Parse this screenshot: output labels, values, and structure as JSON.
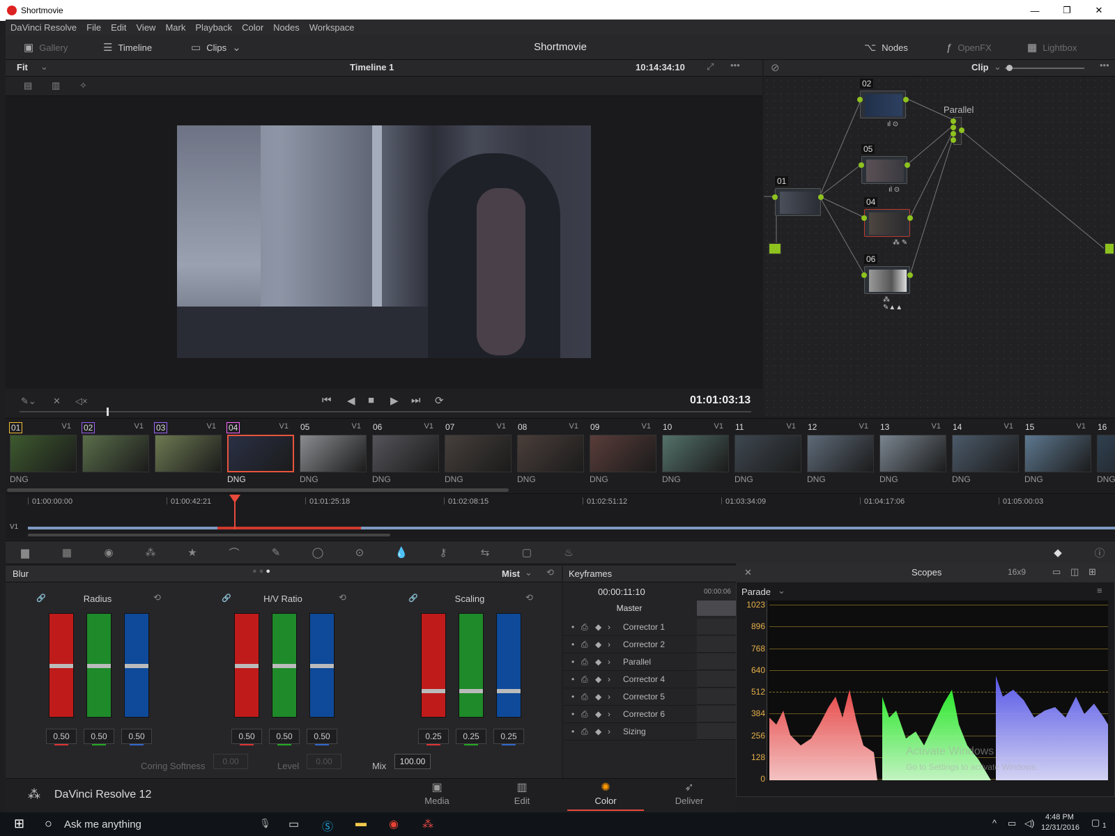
{
  "window": {
    "title": "Shortmovie",
    "controls": [
      "—",
      "❐",
      "✕"
    ]
  },
  "menu": [
    "DaVinci Resolve",
    "File",
    "Edit",
    "View",
    "Mark",
    "Playback",
    "Color",
    "Nodes",
    "Workspace"
  ],
  "toolbar": {
    "gallery": "Gallery",
    "timeline": "Timeline",
    "clips": "Clips",
    "project": "Shortmovie",
    "nodes": "Nodes",
    "openfx": "OpenFX",
    "lightbox": "Lightbox"
  },
  "viewer": {
    "fit": "Fit",
    "timeline_name": "Timeline 1",
    "source_tc": "10:14:34:10",
    "timecode": "01:01:03:13"
  },
  "node_header": {
    "mode": "Clip"
  },
  "nodes": {
    "n01": "01",
    "n02": "02",
    "n05": "05",
    "n04": "04",
    "n06": "06",
    "parallel": "Parallel"
  },
  "clips": [
    {
      "num": "01",
      "track": "V1",
      "fmt": "DNG"
    },
    {
      "num": "02",
      "track": "V1",
      "fmt": ""
    },
    {
      "num": "03",
      "track": "V1",
      "fmt": ""
    },
    {
      "num": "04",
      "track": "V1",
      "fmt": "DNG"
    },
    {
      "num": "05",
      "track": "V1",
      "fmt": "DNG"
    },
    {
      "num": "06",
      "track": "V1",
      "fmt": "DNG"
    },
    {
      "num": "07",
      "track": "V1",
      "fmt": "DNG"
    },
    {
      "num": "08",
      "track": "V1",
      "fmt": "DNG"
    },
    {
      "num": "09",
      "track": "V1",
      "fmt": "DNG"
    },
    {
      "num": "10",
      "track": "V1",
      "fmt": "DNG"
    },
    {
      "num": "11",
      "track": "V1",
      "fmt": "DNG"
    },
    {
      "num": "12",
      "track": "V1",
      "fmt": "DNG"
    },
    {
      "num": "13",
      "track": "V1",
      "fmt": "DNG"
    },
    {
      "num": "14",
      "track": "V1",
      "fmt": "DNG"
    },
    {
      "num": "15",
      "track": "V1",
      "fmt": "DNG"
    },
    {
      "num": "16",
      "track": "",
      "fmt": "DNG"
    }
  ],
  "timeline": {
    "track": "V1",
    "ticks": [
      "01:00:00:00",
      "01:00:42:21",
      "01:01:25:18",
      "01:02:08:15",
      "01:02:51:12",
      "01:03:34:09",
      "01:04:17:06",
      "01:05:00:03"
    ]
  },
  "blur": {
    "title": "Blur",
    "mode": "Mist",
    "groups": [
      {
        "label": "Radius",
        "values": [
          "0.50",
          "0.50",
          "0.50"
        ],
        "level": 0.5
      },
      {
        "label": "H/V Ratio",
        "values": [
          "0.50",
          "0.50",
          "0.50"
        ],
        "level": 0.5
      },
      {
        "label": "Scaling",
        "values": [
          "0.25",
          "0.25",
          "0.25"
        ],
        "level": 0.25
      }
    ],
    "coring_label": "Coring Softness",
    "coring_value": "0.00",
    "level_label": "Level",
    "level_value": "0.00",
    "mix_label": "Mix",
    "mix_value": "100.00"
  },
  "keyframes": {
    "title": "Keyframes",
    "timecode": "00:00:11:10",
    "ruler": "00:00:06",
    "master": "Master",
    "rows": [
      "Corrector 1",
      "Corrector 2",
      "Parallel",
      "Corrector 4",
      "Corrector 5",
      "Corrector 6",
      "Sizing"
    ]
  },
  "scopes": {
    "title": "Scopes",
    "aspect": "16x9",
    "mode": "Parade",
    "y_labels": [
      "1023",
      "896",
      "768",
      "640",
      "512",
      "384",
      "256",
      "128",
      "0"
    ],
    "watermark1": "Activate Windows",
    "watermark2": "Go to Settings to activate Windows."
  },
  "pages": {
    "brand": "DaVinci Resolve 12",
    "media": "Media",
    "edit": "Edit",
    "color": "Color",
    "deliver": "Deliver"
  },
  "taskbar": {
    "search": "Ask me anything",
    "time": "4:48 PM",
    "date": "12/31/2016",
    "notif": "1"
  },
  "colors": {
    "accent_green": "#8ec21f",
    "playhead_red": "#e84a3b",
    "scope_label": "#e6b04a"
  }
}
